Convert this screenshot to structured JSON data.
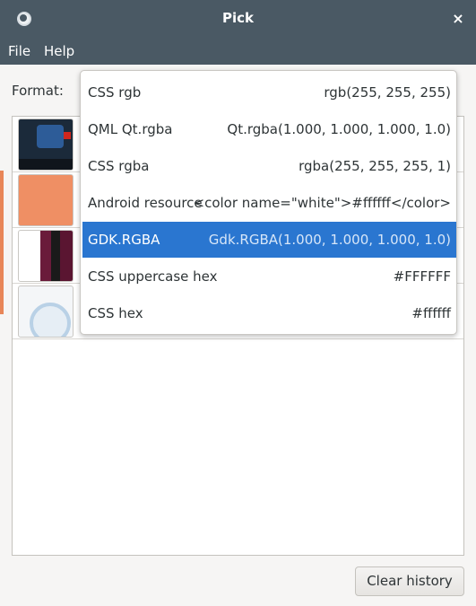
{
  "window": {
    "title": "Pick",
    "close_glyph": "×",
    "app_icon": "pick-app-icon"
  },
  "menubar": {
    "file": "File",
    "help": "Help"
  },
  "format": {
    "label": "Format:"
  },
  "format_options": [
    {
      "name": "CSS rgb",
      "value": "rgb(255, 255, 255)",
      "selected": false
    },
    {
      "name": "QML Qt.rgba",
      "value": "Qt.rgba(1.000, 1.000, 1.000, 1.0)",
      "selected": false
    },
    {
      "name": "CSS rgba",
      "value": "rgba(255, 255, 255, 1)",
      "selected": false
    },
    {
      "name": "Android resource",
      "value": "<color name=\"white\">#ffffff</color>",
      "selected": false
    },
    {
      "name": "GDK.RGBA",
      "value": "Gdk.RGBA(1.000, 1.000, 1.000, 1.0)",
      "selected": true
    },
    {
      "name": "CSS uppercase hex",
      "value": "#FFFFFF",
      "selected": false
    },
    {
      "name": "CSS hex",
      "value": "#ffffff",
      "selected": false
    }
  ],
  "history": {
    "thumbnails": [
      "video-screenshot-thumbnail",
      "orange-swatch-thumbnail",
      "dark-stripes-thumbnail",
      "magnifier-thumbnail"
    ]
  },
  "actions": {
    "clear_history": "Clear history"
  },
  "colors": {
    "header_bg": "#4a5964",
    "selected_bg": "#2a76d0",
    "window_bg": "#f6f5f4"
  }
}
